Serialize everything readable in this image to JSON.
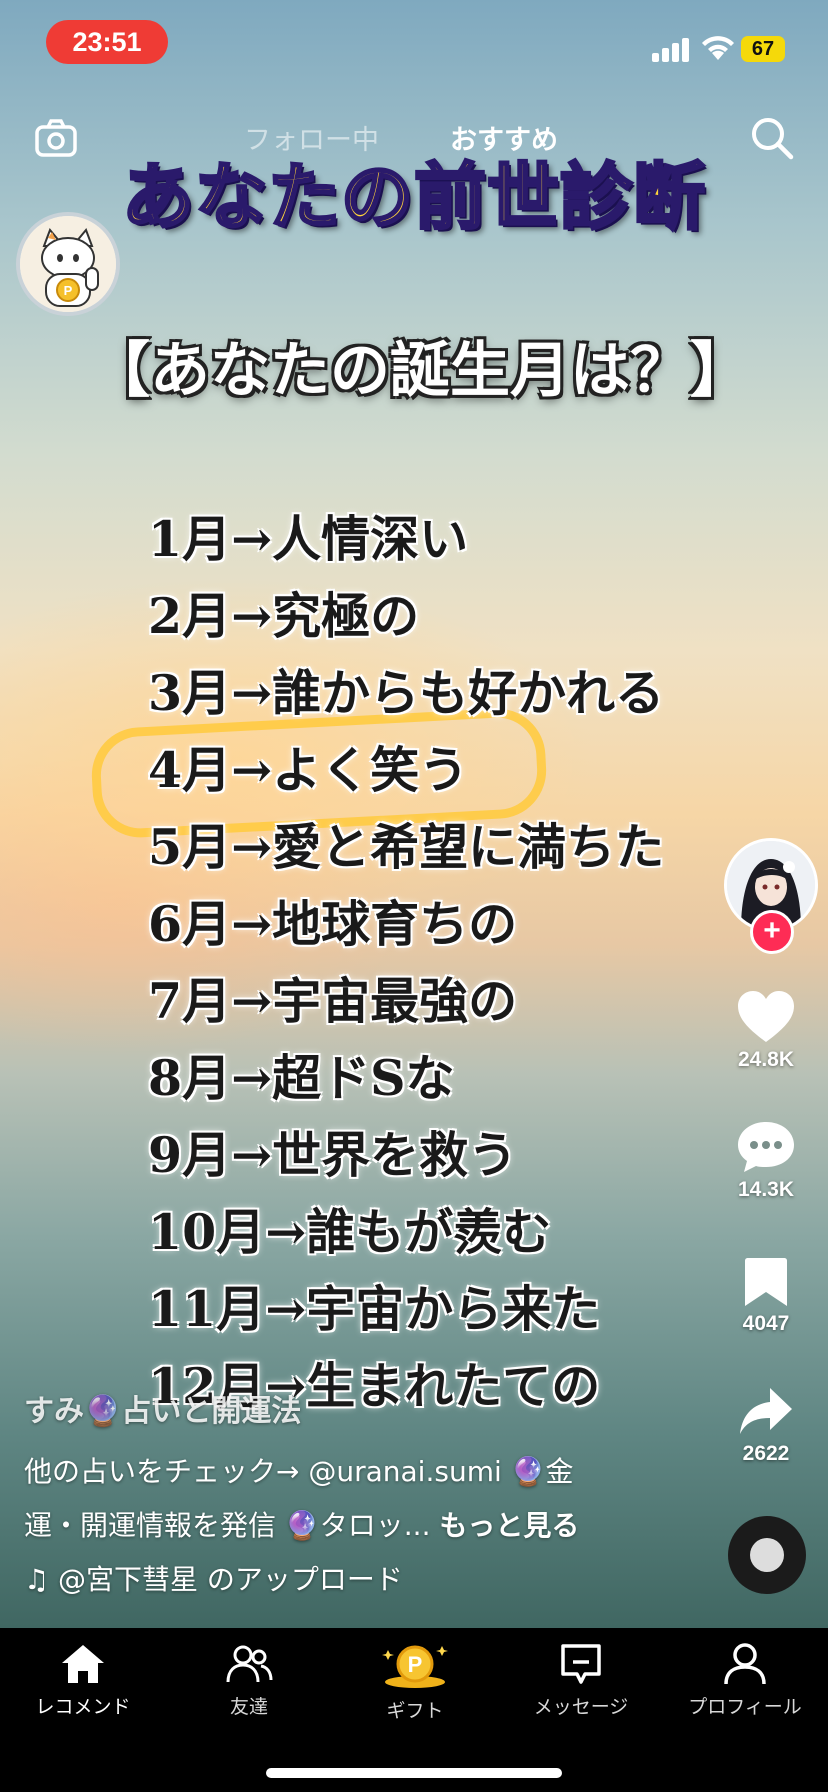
{
  "status_bar": {
    "time": "23:51",
    "battery": "67"
  },
  "top_nav": {
    "tabs": [
      "フォロー中",
      "おすすめ"
    ],
    "active_tab": "おすすめ"
  },
  "video": {
    "title": "あなたの前世診断",
    "subtitle": "【あなたの誕生月は？】",
    "items": [
      "1月→人情深い",
      "2月→究極の",
      "3月→誰からも好かれる",
      "4月→よく笑う",
      "5月→愛と希望に満ちた",
      "6月→地球育ちの",
      "7月→宇宙最強の",
      "8月→超ドSな",
      "9月→世界を救う",
      "10月→誰もが羨む",
      "11月→宇宙から来た",
      "12月→生まれたての"
    ],
    "highlighted_item": "4月→よく笑う",
    "highlight_color": "#ffca3c"
  },
  "actions": {
    "likes": "24.8K",
    "comments": "14.3K",
    "saves": "4047",
    "shares": "2622"
  },
  "caption": {
    "author": "すみ🔮占いと開運法",
    "line1": "他の占いをチェック→ @uranai.sumi 🔮金",
    "line2": "運・開運情報を発信 🔮タロッ...",
    "more": "もっと見る",
    "music": "@宮下彗星 のアップロード"
  },
  "bottom_nav": {
    "items": [
      "レコメンド",
      "友達",
      "ギフト",
      "メッセージ",
      "プロフィール"
    ]
  },
  "colors": {
    "accent": "#fe2c55",
    "status_pill": "#ef3b35",
    "title_fill": "#ffd43b",
    "battery": "#f5d90a"
  }
}
